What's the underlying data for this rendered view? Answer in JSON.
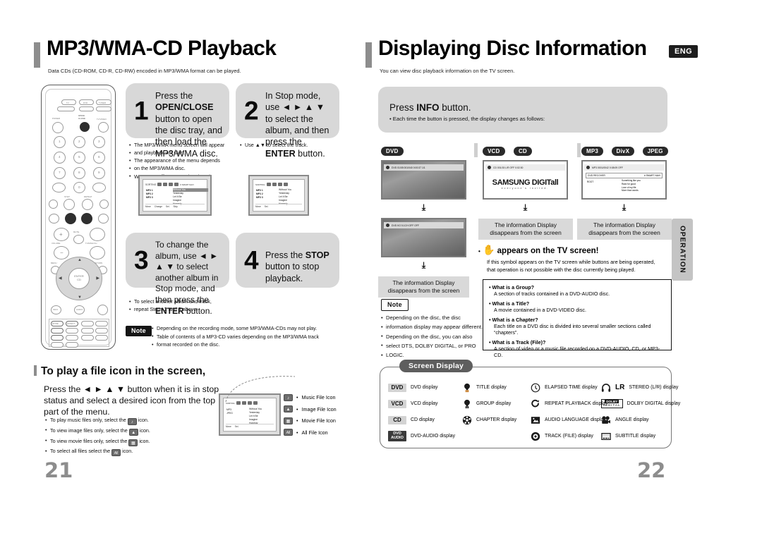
{
  "left_page": {
    "title": "MP3/WMA-CD Playback",
    "subtitle": "Data CDs (CD-ROM, CD-R, CD-RW) encoded in MP3/WMA format can be played.",
    "page_number": "21",
    "steps": [
      {
        "number": "1",
        "text_parts": [
          "Press the ",
          "OPEN/CLOSE",
          " button to open the disc tray, and then load the MP3/WMA disc."
        ],
        "bullets": [
          "The MP3/WMA menu screen will appear",
          "and playback will start.",
          "The appearance of the menu depends",
          "on the MP3/WMA disc.",
          "WMA-DRM files cannot be played."
        ]
      },
      {
        "number": "2",
        "text_parts": [
          "In Stop mode, use ",
          "◄ ► ▲ ▼",
          " to select the album, and then press the ",
          "ENTER",
          " button."
        ],
        "bullets": [
          "Use ▲▼ to select the track."
        ]
      },
      {
        "number": "3",
        "text_parts": [
          "To change the album, use ",
          "◄ ► ▲ ▼",
          " to select another album in Stop mode, and then press the ",
          "ENTER",
          " button."
        ],
        "bullets": [
          "To select another album and track,",
          "repeat Steps 2 and 3 above."
        ]
      },
      {
        "number": "4",
        "text_parts": [
          "Press the ",
          "STOP",
          " button to stop playback."
        ],
        "bullets": []
      }
    ],
    "note": {
      "label": "Note",
      "lines": [
        "Depending on the recording mode, some MP3/WMA-CDs may not play.",
        "Table of contents of a MP3-CD varies depending on the MP3/WMA track",
        "format recorded on the disc."
      ]
    },
    "file_icon_section": {
      "heading": "To play a file icon in the screen,",
      "paragraph_lines": [
        "Press the ◄ ► ▲ ▼ button when it is in stop",
        "status and select a desired icon from the top",
        "part of the menu."
      ],
      "bullets": [
        {
          "pre": "To play music files only, select the",
          "chip": "♪",
          "post": "icon."
        },
        {
          "pre": "To view image files only, select the",
          "chip": "▲",
          "post": "icon."
        },
        {
          "pre": "To view movie files only, select the",
          "chip": "▦",
          "post": "icon."
        },
        {
          "pre": "To select all files select the",
          "chip": "All",
          "post": "icon."
        }
      ],
      "legend": [
        {
          "chip": "♪",
          "label": "Music File Icon"
        },
        {
          "chip": "▲",
          "label": "Image File Icon"
        },
        {
          "chip": "▦",
          "label": "Movie File Icon"
        },
        {
          "chip": "All",
          "label": "All File Icon"
        }
      ]
    },
    "menu_screens": {
      "sort_label": "SORTING",
      "smart_navi": "# SMART NAVI",
      "albums": [
        "MP3 1",
        "MP3 2",
        "MP3 3"
      ],
      "tracks": [
        "Without You",
        "Yesterday",
        "Let It Be",
        "Imagine",
        "Honesty"
      ],
      "footer": [
        "Move",
        "Change",
        "Sel.",
        "Skip"
      ]
    }
  },
  "right_page": {
    "title": "Displaying Disc Information",
    "subtitle": "You can view disc playback information  on the TV screen.",
    "lang_badge": "ENG",
    "page_number": "22",
    "side_tab": "OPERATION",
    "info_box": {
      "heading_parts": [
        "Press ",
        "INFO",
        " button."
      ],
      "bullet": "Each time the button is pressed, the display changes as follows:"
    },
    "columns": [
      {
        "discs": [
          "DVD"
        ],
        "screens": [
          {
            "osd": "DVD  01/05   001/040   0:00:37   1/1"
          },
          {
            "osd": "DVD   KO 5.1CH   OFF   OFF"
          }
        ],
        "caption": [
          "The information Display",
          "disappears from the screen"
        ]
      },
      {
        "discs": [
          "VCD",
          "CD"
        ],
        "screens": [
          {
            "osd": "CD   001/15   L/R   OFF   0:02:30",
            "brand": "SAMSUNG DIGITall",
            "brand_sub": "everyone's invited."
          }
        ],
        "caption": [
          "The information Display",
          "disappears from the screen"
        ]
      },
      {
        "discs": [
          "MP3",
          "DivX",
          "JPEG"
        ],
        "screens": [
          {
            "osd": "MP3   0001/0042   0:08:09   OFF",
            "path": "DVD RECOVER",
            "navi": "# SMART NAVI",
            "root": "ROOT",
            "tracks": [
              "Something like you",
              "Rack for good",
              "Love of my life",
              "More than words"
            ]
          }
        ],
        "caption": [
          "The information Display",
          "disappears from the screen"
        ]
      }
    ],
    "symbol_note": {
      "heading": "appears on the TV screen!",
      "lines": [
        "If this symbol appears on the TV screen while buttons are being operated,",
        "that operation is not possible with the disc currently being played."
      ]
    },
    "note": {
      "label": "Note",
      "lines": [
        "Depending on the disc, the disc",
        "information display may appear different.",
        "Depending on the disc, you can also",
        "select DTS, DOLBY DIGITAL, or PRO",
        "LOGIC."
      ]
    },
    "qa": [
      {
        "q": "What is a Group?",
        "a": [
          "A section of tracks contained in a DVD-AUDIO disc."
        ]
      },
      {
        "q": "What is a Title?",
        "a": [
          "A movie contained in a DVD-VIDEO disc."
        ]
      },
      {
        "q": "What is a Chapter?",
        "a": [
          "Each title on a DVD disc is divided into several smaller sections called",
          "“chapters”."
        ]
      },
      {
        "q": "What is a Track (File)?",
        "a": [
          "A section of video or a music file recorded on a DVD-AUDIO, CD, or MP3-CD."
        ]
      }
    ],
    "screen_display": {
      "title": "Screen Display",
      "col1": [
        {
          "tag": "DVD",
          "label": "DVD display"
        },
        {
          "tag": "VCD",
          "label": "VCD display"
        },
        {
          "tag": "CD",
          "label": "CD display"
        },
        {
          "tag": "DVD AUDIO",
          "label": "DVD-AUDIO display"
        }
      ],
      "col2": [
        {
          "icon": "title-icon",
          "label": "TITLE display"
        },
        {
          "icon": "group-icon",
          "label": "GROUP display"
        },
        {
          "icon": "chapter-icon",
          "label": "CHAPTER display"
        }
      ],
      "col3": [
        {
          "icon": "clock-icon",
          "label": "ELAPSED TIME display"
        },
        {
          "icon": "repeat-icon",
          "label": "REPEAT PLAYBACK display"
        },
        {
          "icon": "audio-language-icon",
          "label": "AUDIO LANGUAGE display"
        },
        {
          "icon": "track-icon",
          "label": "TRACK (FILE) display"
        }
      ],
      "col4": [
        {
          "icon": "headphone-icon",
          "label": "STEREO (L/R) display",
          "pre": "LR"
        },
        {
          "icon": "dolby-icon",
          "label": "DOLBY DIGITAL display"
        },
        {
          "icon": "camera-icon",
          "label": "ANGLE display"
        },
        {
          "icon": "subtitle-icon",
          "label": "SUBTITLE display"
        }
      ]
    }
  }
}
